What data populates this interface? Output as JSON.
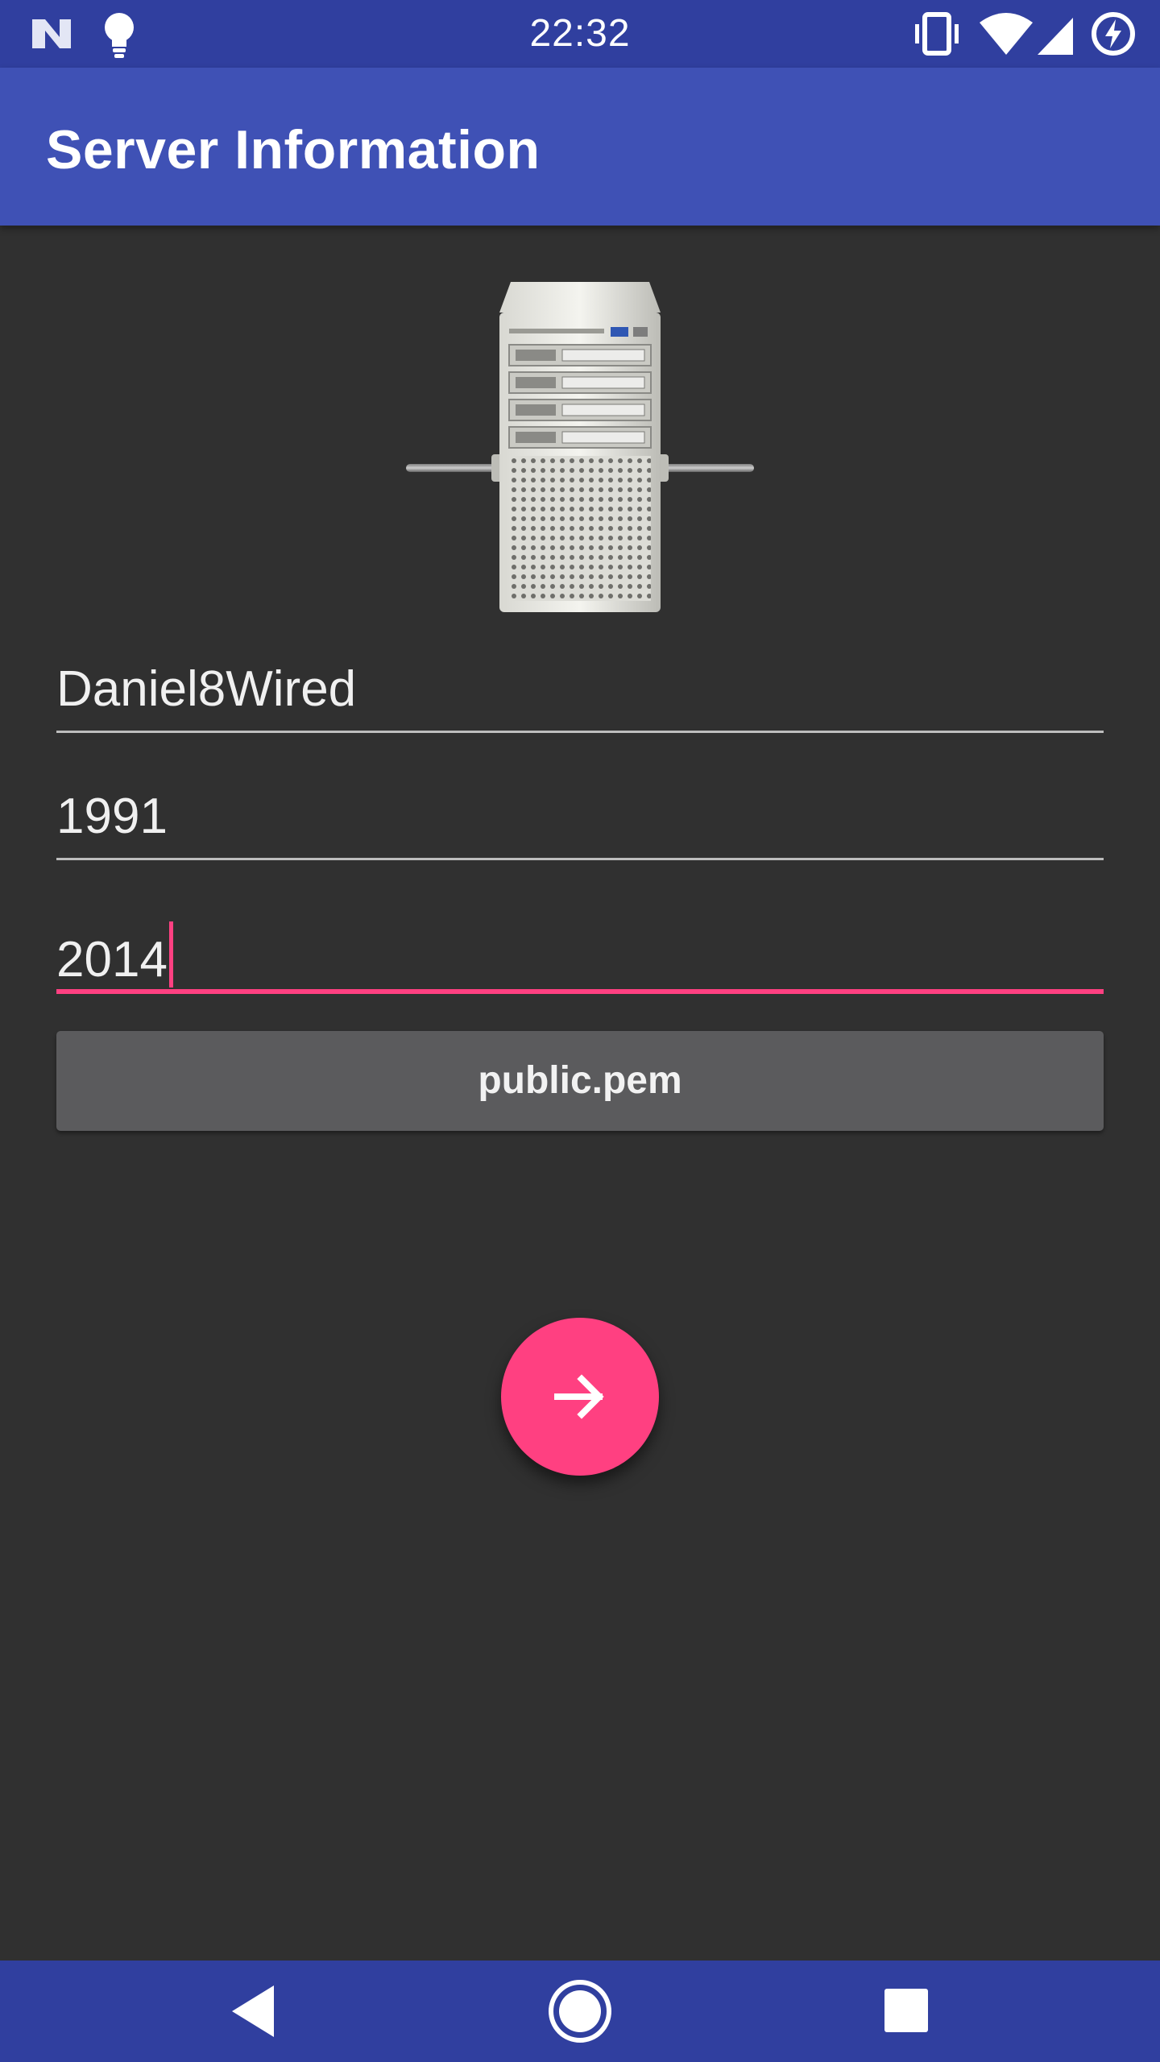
{
  "status_bar": {
    "time": "22:32",
    "icons": [
      "n-notification-icon",
      "lightbulb-icon",
      "vibrate-icon",
      "wifi-icon",
      "signal-icon",
      "battery-saver-icon"
    ]
  },
  "app_bar": {
    "title": "Server Information"
  },
  "server_image": {
    "icon": "server-tower-image"
  },
  "form": {
    "server_name": "Daniel8Wired",
    "port_one": "1991",
    "port_two": "2014",
    "file_button_label": "public.pem"
  },
  "fab": {
    "icon": "arrow-forward-icon"
  },
  "nav_bar": {
    "icons": [
      "back-icon",
      "home-icon",
      "recents-icon"
    ]
  },
  "colors": {
    "primary_dark": "#303f9f",
    "primary": "#3f51b5",
    "accent": "#ff4081",
    "background": "#303030",
    "button": "#5b5b5d"
  }
}
